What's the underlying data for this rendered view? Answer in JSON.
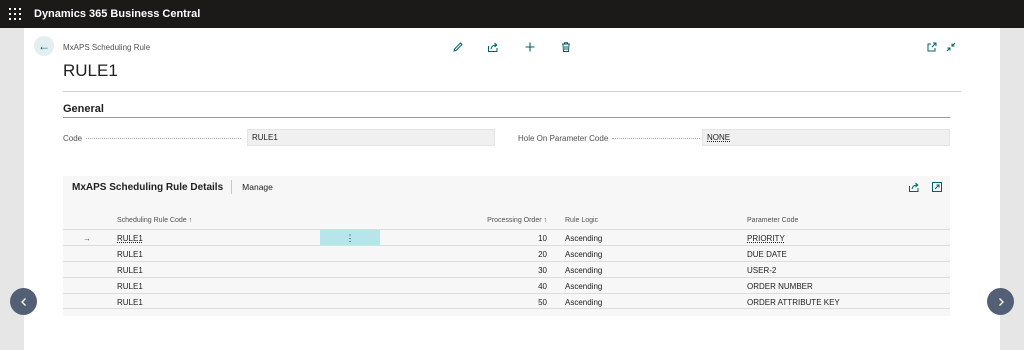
{
  "app": {
    "title": "Dynamics 365 Business Central"
  },
  "header": {
    "breadcrumb": "MxAPS Scheduling Rule",
    "record_title": "RULE1",
    "actions": [
      "edit-icon",
      "share-icon",
      "new-icon",
      "delete-icon"
    ],
    "window_actions": [
      "open-new-window-icon",
      "collapse-icon"
    ]
  },
  "general": {
    "title": "General",
    "code_label": "Code",
    "code_value": "RULE1",
    "hole_label": "Hole On Parameter Code",
    "hole_value": "NONE"
  },
  "details": {
    "title": "MxAPS Scheduling Rule Details",
    "manage_label": "Manage",
    "columns": {
      "code": "Scheduling Rule Code ↑",
      "order": "Processing Order ↑",
      "logic": "Rule Logic",
      "param": "Parameter Code"
    },
    "rows": [
      {
        "code": "RULE1",
        "order": "10",
        "logic": "Ascending",
        "param": "PRIORITY"
      },
      {
        "code": "RULE1",
        "order": "20",
        "logic": "Ascending",
        "param": "DUE DATE"
      },
      {
        "code": "RULE1",
        "order": "30",
        "logic": "Ascending",
        "param": "USER-2"
      },
      {
        "code": "RULE1",
        "order": "40",
        "logic": "Ascending",
        "param": "ORDER NUMBER"
      },
      {
        "code": "RULE1",
        "order": "50",
        "logic": "Ascending",
        "param": "ORDER ATTRIBUTE KEY"
      }
    ],
    "row_menu_glyph": "⋮",
    "selected_row_arrow": "→"
  },
  "colors": {
    "accent": "#00616a",
    "topbar": "#1b1a19",
    "selection": "#b7e6ea",
    "nav_button": "#525f75"
  }
}
